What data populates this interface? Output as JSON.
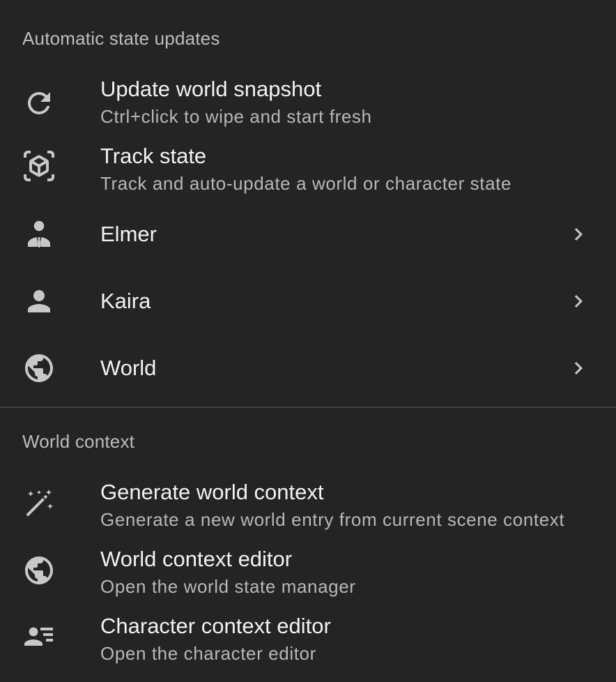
{
  "sections": [
    {
      "header": "Automatic state updates",
      "items": [
        {
          "title": "Update world snapshot",
          "subtitle": "Ctrl+click to wipe and start fresh",
          "icon": "refresh-icon"
        },
        {
          "title": "Track state",
          "subtitle": "Track and auto-update a world or character state",
          "icon": "view-in-ar-icon"
        },
        {
          "title": "Elmer",
          "icon": "person-tie-icon",
          "has_submenu": true
        },
        {
          "title": "Kaira",
          "icon": "person-icon",
          "has_submenu": true
        },
        {
          "title": "World",
          "icon": "globe-icon",
          "has_submenu": true
        }
      ]
    },
    {
      "header": "World context",
      "items": [
        {
          "title": "Generate world context",
          "subtitle": "Generate a new world entry from current scene context",
          "icon": "magic-wand-icon"
        },
        {
          "title": "World context editor",
          "subtitle": "Open the world state manager",
          "icon": "globe-icon"
        },
        {
          "title": "Character context editor",
          "subtitle": "Open the character editor",
          "icon": "person-list-icon"
        }
      ]
    }
  ],
  "colors": {
    "background": "#242424",
    "text_primary": "#f2f2f2",
    "text_secondary": "#b8b8b8",
    "icon": "#c8c8c8",
    "divider": "#3e3e3e"
  }
}
